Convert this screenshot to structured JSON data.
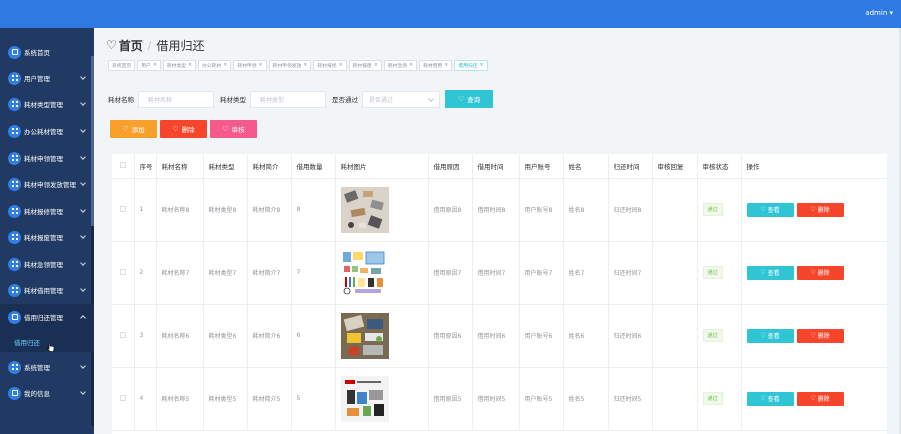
{
  "topbar": {
    "user": "admin ▾",
    "color": "#2d7be0"
  },
  "sidebar": {
    "items": [
      {
        "label": "系统首页",
        "icon": "home-icon"
      },
      {
        "label": "用户管理",
        "icon": "grid-icon"
      },
      {
        "label": "耗材类型管理",
        "icon": "grid-icon"
      },
      {
        "label": "办公耗材管理",
        "icon": "grid-icon"
      },
      {
        "label": "耗材申领管理",
        "icon": "grid-icon"
      },
      {
        "label": "耗材申领发放管理",
        "icon": "grid-icon"
      },
      {
        "label": "耗材报修管理",
        "icon": "grid-icon"
      },
      {
        "label": "耗材报废管理",
        "icon": "grid-icon"
      },
      {
        "label": "耗材急领管理",
        "icon": "grid-icon"
      },
      {
        "label": "耗材借用管理",
        "icon": "grid-icon"
      },
      {
        "label": "借用归还管理",
        "icon": "grid-icon"
      },
      {
        "label": "系统管理",
        "icon": "grid-icon"
      },
      {
        "label": "我的信息",
        "icon": "grid-icon"
      }
    ],
    "sub_item": "借用归还"
  },
  "breadcrumb": {
    "home": "首页",
    "current": "借用归还"
  },
  "tabs": [
    {
      "label": "系统首页"
    },
    {
      "label": "用户"
    },
    {
      "label": "耗材类型"
    },
    {
      "label": "办公耗材"
    },
    {
      "label": "耗材申领"
    },
    {
      "label": "耗材申领发放"
    },
    {
      "label": "耗材报修"
    },
    {
      "label": "耗材报废"
    },
    {
      "label": "耗材急领"
    },
    {
      "label": "耗材借用"
    },
    {
      "label": "借用归还"
    }
  ],
  "search": {
    "name_label": "耗材名称",
    "name_placeholder": "耗材名称",
    "type_label": "耗材类型",
    "type_placeholder": "耗材类型",
    "pass_label": "是否通过",
    "pass_placeholder": "是否通过",
    "query_label": "查询"
  },
  "actions": {
    "add": "添加",
    "delete": "删除",
    "audit": "审核"
  },
  "table": {
    "headers": [
      "序号",
      "耗材名称",
      "耗材类型",
      "耗材简介",
      "借用数量",
      "耗材图片",
      "借用原因",
      "借用时间",
      "用户账号",
      "姓名",
      "归还时间",
      "审核回复",
      "审核状态",
      "操作"
    ],
    "rows": [
      {
        "no": "1",
        "name": "耗材名称8",
        "type": "耗材类型8",
        "intro": "耗材简介8",
        "qty": "8",
        "reason": "借用原因8",
        "time": "借用时间8",
        "account": "用户账号8",
        "person": "姓名8",
        "return_time": "归还时间8",
        "reply": "",
        "status": "通过"
      },
      {
        "no": "2",
        "name": "耗材名称7",
        "type": "耗材类型7",
        "intro": "耗材简介7",
        "qty": "7",
        "reason": "借用原因7",
        "time": "借用时间7",
        "account": "用户账号7",
        "person": "姓名7",
        "return_time": "归还时间7",
        "reply": "",
        "status": "通过"
      },
      {
        "no": "3",
        "name": "耗材名称6",
        "type": "耗材类型6",
        "intro": "耗材简介6",
        "qty": "6",
        "reason": "借用原因6",
        "time": "借用时间6",
        "account": "用户账号6",
        "person": "姓名6",
        "return_time": "归还时间6",
        "reply": "",
        "status": "通过"
      },
      {
        "no": "4",
        "name": "耗材名称5",
        "type": "耗材类型5",
        "intro": "耗材简介5",
        "qty": "5",
        "reason": "借用原因5",
        "time": "借用时间5",
        "account": "用户账号5",
        "person": "姓名5",
        "return_time": "归还时间5",
        "reply": "",
        "status": "通过"
      }
    ],
    "view_label": "查看",
    "delete_label": "删除"
  }
}
